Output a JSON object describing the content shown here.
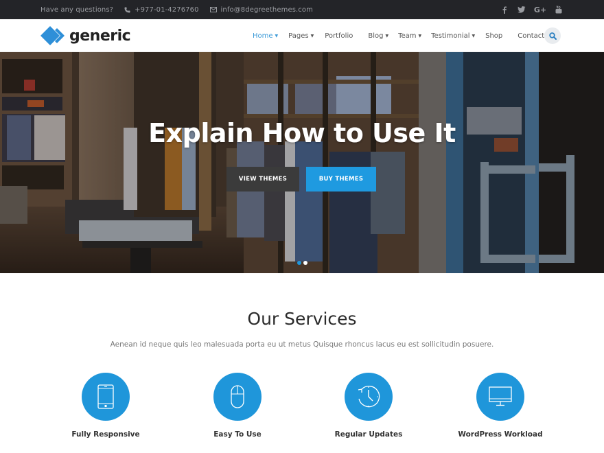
{
  "topbar": {
    "question": "Have any questions?",
    "phone": "+977-01-4276760",
    "email": "info@8degreethemes.com",
    "social": [
      {
        "name": "facebook-icon",
        "glyph": "f"
      },
      {
        "name": "twitter-icon",
        "glyph": "t"
      },
      {
        "name": "google-plus-icon",
        "glyph": "G+"
      },
      {
        "name": "youtube-icon",
        "glyph": "yt"
      }
    ]
  },
  "header": {
    "logo_text": "generic",
    "nav": [
      {
        "label": "Home",
        "dropdown": true,
        "active": true
      },
      {
        "label": "Pages",
        "dropdown": true
      },
      {
        "label": "Portfolio",
        "dropdown": false
      },
      {
        "label": "Blog",
        "dropdown": true
      },
      {
        "label": "Team",
        "dropdown": true
      },
      {
        "label": "Testimonial",
        "dropdown": true
      },
      {
        "label": "Shop",
        "dropdown": false
      },
      {
        "label": "Contact Us",
        "dropdown": false
      }
    ],
    "caret": "▼"
  },
  "hero": {
    "title": "Explain How to Use It",
    "buttons": {
      "view": "VIEW THEMES",
      "buy": "BUY THEMES"
    },
    "slides": 2,
    "active_slide": 1
  },
  "services": {
    "title": "Our Services",
    "subtitle": "Aenean id neque quis leo malesuada porta eu ut metus Quisque rhoncus lacus eu est sollicitudin posuere.",
    "items": [
      {
        "name": "Fully Responsive",
        "icon": "tablet-icon"
      },
      {
        "name": "Easy To Use",
        "icon": "mouse-icon"
      },
      {
        "name": "Regular Updates",
        "icon": "clock-refresh-icon"
      },
      {
        "name": "WordPress Workload",
        "icon": "monitor-icon"
      }
    ]
  },
  "colors": {
    "accent": "#1f96da",
    "topbar_bg": "#232428",
    "dark_button": "#3b3b3b",
    "nav_active": "#3d9bd8"
  }
}
